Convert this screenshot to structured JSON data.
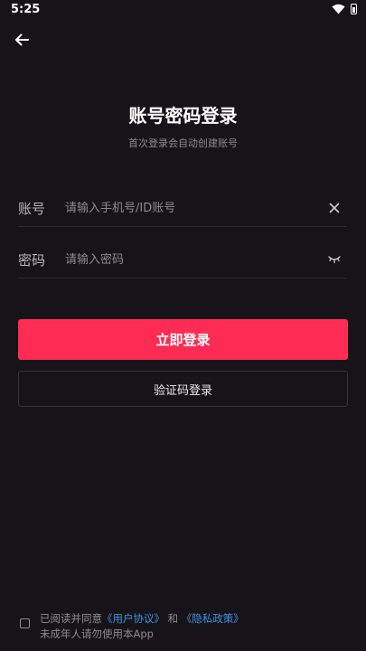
{
  "status_bar": {
    "time": "5:25",
    "wifi_icon": "wifi-icon",
    "battery_icon": "battery-icon"
  },
  "header": {
    "back_icon": "arrow-left-icon"
  },
  "page": {
    "title": "账号密码登录",
    "subtitle": "首次登录会自动创建账号"
  },
  "form": {
    "account": {
      "label": "账号",
      "value": "",
      "placeholder": "请输入手机号/ID账号",
      "action_icon": "clear-icon"
    },
    "password": {
      "label": "密码",
      "value": "",
      "placeholder": "请输入密码",
      "action_icon": "eye-closed-icon"
    }
  },
  "buttons": {
    "login_label": "立即登录",
    "code_login_label": "验证码登录"
  },
  "agreement": {
    "prefix": "已阅读并同意",
    "user_agreement": "《用户协议》",
    "and": "和",
    "privacy_policy": "《隐私政策》",
    "minor_notice": "未成年人请勿使用本App"
  },
  "colors": {
    "background": "#161419",
    "accent": "#fe2c55",
    "link": "#3f8fe0",
    "muted_text": "#8c8a90"
  }
}
